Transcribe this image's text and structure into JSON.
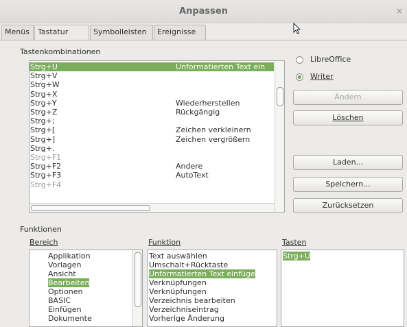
{
  "window": {
    "title": "Anpassen",
    "close_glyph": "×"
  },
  "tabs": [
    "Menüs",
    "Tastatur",
    "Symbolleisten",
    "Ereignisse"
  ],
  "shortcuts": {
    "heading": "Tastenkombinationen",
    "rows": [
      {
        "key": "Strg+U",
        "command": "Unformatierten Text ein",
        "state": "selected"
      },
      {
        "key": "Strg+V",
        "command": "",
        "state": "normal"
      },
      {
        "key": "Strg+W",
        "command": "",
        "state": "normal"
      },
      {
        "key": "Strg+X",
        "command": "",
        "state": "normal"
      },
      {
        "key": "Strg+Y",
        "command": "Wiederherstellen",
        "state": "normal"
      },
      {
        "key": "Strg+Z",
        "command": "Rückgängig",
        "state": "normal"
      },
      {
        "key": "Strg+;",
        "command": "",
        "state": "normal"
      },
      {
        "key": "Strg+[",
        "command": "Zeichen verkleinern",
        "state": "normal"
      },
      {
        "key": "Strg+]",
        "command": "Zeichen vergrößern",
        "state": "normal"
      },
      {
        "key": "Strg+.",
        "command": "",
        "state": "normal"
      },
      {
        "key": "Strg+F1",
        "command": "",
        "state": "muted"
      },
      {
        "key": "Strg+F2",
        "command": "Andere",
        "state": "normal"
      },
      {
        "key": "Strg+F3",
        "command": "AutoText",
        "state": "normal"
      },
      {
        "key": "Strg+F4",
        "command": "",
        "state": "muted"
      }
    ]
  },
  "scope": {
    "option_libreoffice": "LibreOffice",
    "option_writer": "Writer",
    "selected": "Writer"
  },
  "buttons": {
    "modify": "Ändern",
    "delete": "Löschen",
    "load": "Laden...",
    "save": "Speichern...",
    "reset": "Zurücksetzen"
  },
  "functions": {
    "heading": "Funktionen",
    "category_label": "Bereich",
    "function_label": "Funktion",
    "keys_label": "Tasten",
    "categories": [
      "Applikation",
      "Vorlagen",
      "Ansicht",
      "Bearbeiten",
      "Optionen",
      "BASIC",
      "Einfügen",
      "Dokumente"
    ],
    "selected_category": "Bearbeiten",
    "functions": [
      "Text auswählen",
      "Umschalt+Rücktaste",
      "Unformatierten Text einfüge",
      "Verknüpfungen",
      "Verknüpfungen",
      "Verzeichnis bearbeiten",
      "Verzeichniseintrag",
      "Vorherige Änderung"
    ],
    "selected_function": "Unformatierten Text einfüge",
    "keys": [
      "Strg+U"
    ]
  },
  "colors": {
    "selection": "#7bae5b",
    "radio_on": "#6ea24d"
  }
}
